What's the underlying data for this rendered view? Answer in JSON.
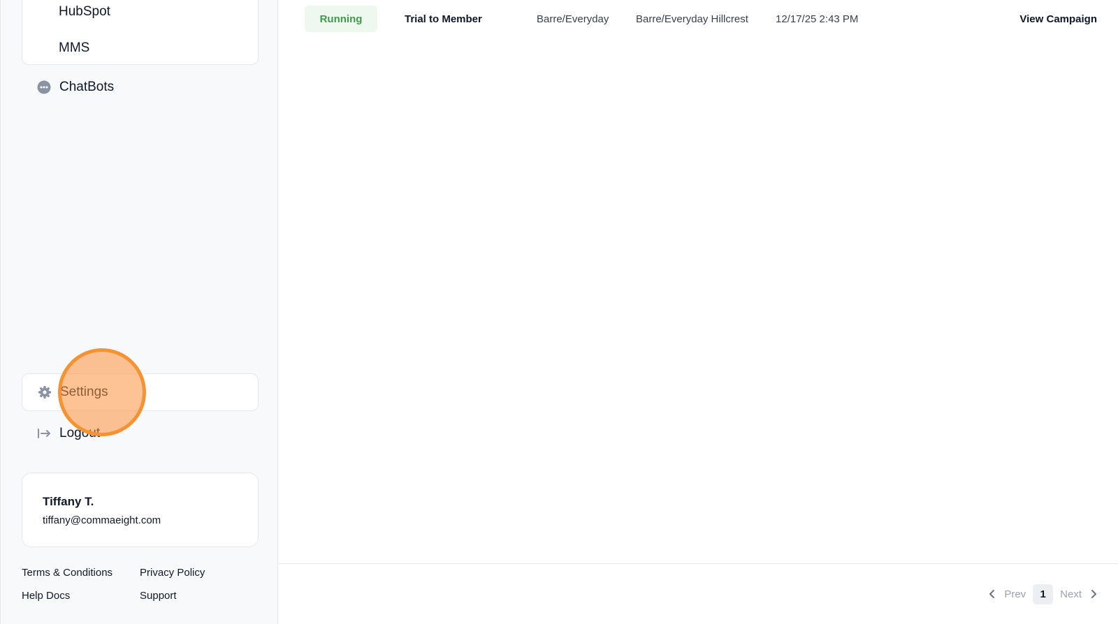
{
  "sidebar": {
    "submenu": [
      "HubSpot",
      "MMS"
    ],
    "chatbots_label": "ChatBots",
    "settings_label": "Settings",
    "logout_label": "Logout",
    "user": {
      "name": "Tiffany T.",
      "email": "tiffany@commaeight.com"
    },
    "footer": {
      "terms": "Terms & Conditions",
      "privacy": "Privacy Policy",
      "help": "Help Docs",
      "support": "Support"
    },
    "icons": {
      "chatbots": "chat-bubble-icon",
      "settings": "gear-icon",
      "logout": "logout-arrow-icon"
    }
  },
  "table": {
    "rows": [
      {
        "status": "Running",
        "name": "Trial to Member",
        "program": "Barre/Everyday",
        "location": "Barre/Everyday Hillcrest",
        "date": "12/17/25 2:43 PM",
        "action": "View Campaign"
      }
    ]
  },
  "pagination": {
    "prev": "Prev",
    "current_page": "1",
    "next": "Next"
  },
  "colors": {
    "status_running_bg": "#eef8ef",
    "status_running_text": "#3f9a4c",
    "click_highlight": "#f59332"
  }
}
